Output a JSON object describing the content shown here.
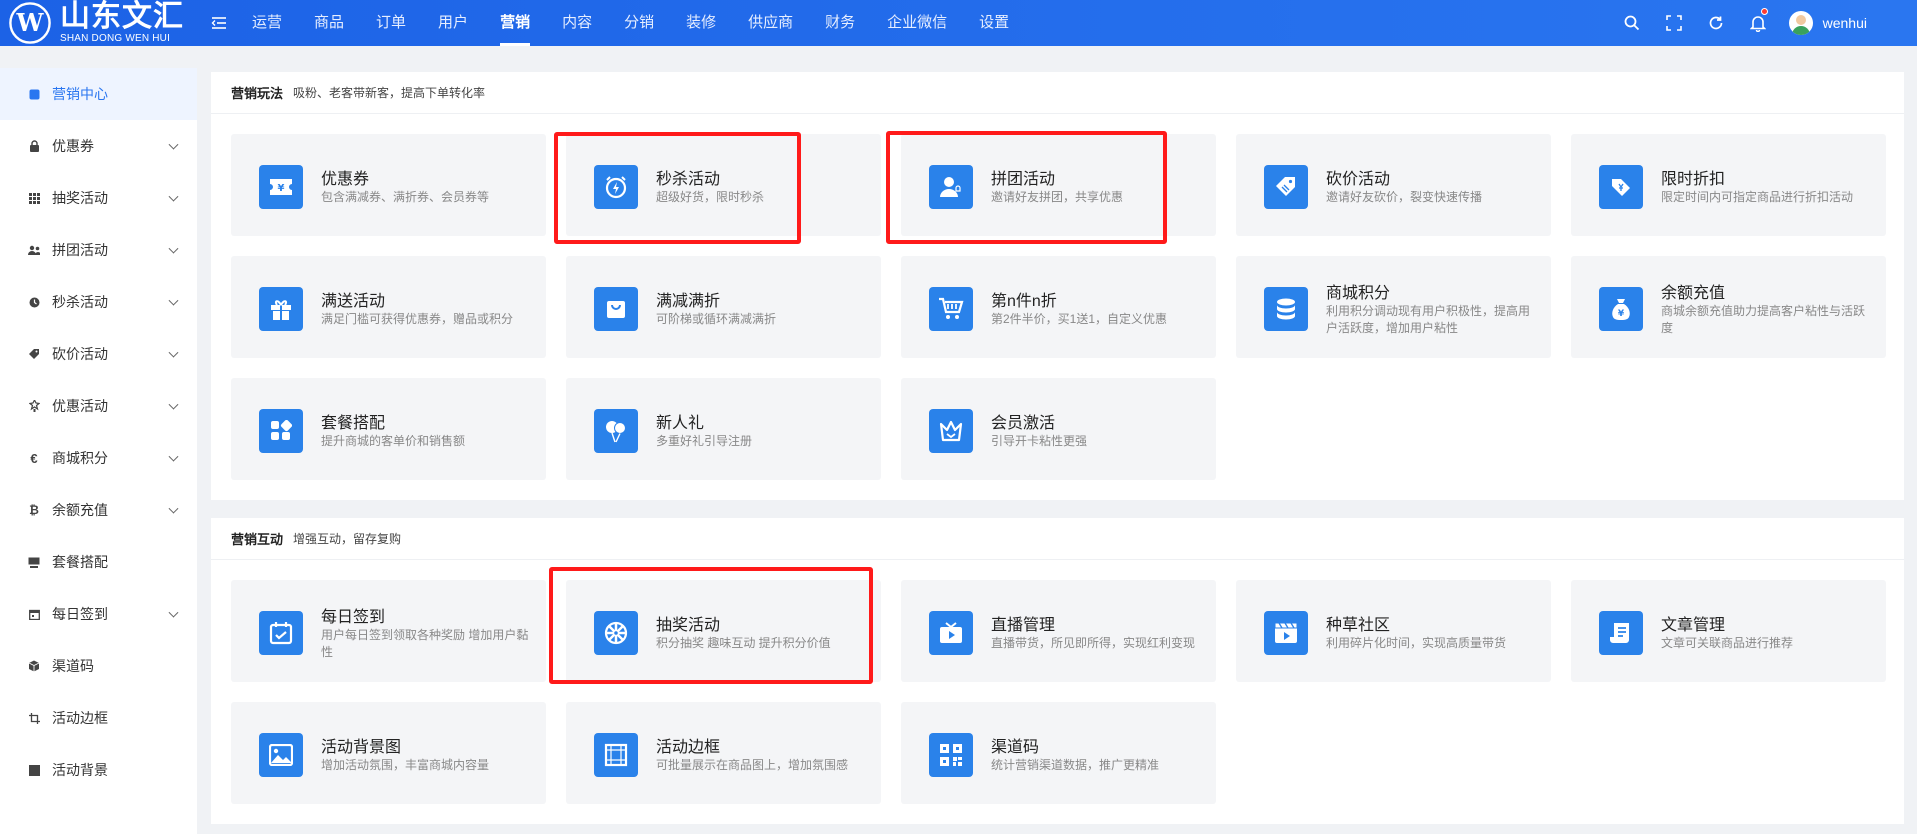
{
  "brand": {
    "name_cn": "山东文汇",
    "name_en": "SHAN DONG WEN HUI",
    "logo_letter": "W"
  },
  "nav": {
    "items": [
      {
        "label": "运营"
      },
      {
        "label": "商品"
      },
      {
        "label": "订单"
      },
      {
        "label": "用户"
      },
      {
        "label": "营销",
        "active": true
      },
      {
        "label": "内容"
      },
      {
        "label": "分销"
      },
      {
        "label": "装修"
      },
      {
        "label": "供应商"
      },
      {
        "label": "财务"
      },
      {
        "label": "企业微信"
      },
      {
        "label": "设置"
      }
    ]
  },
  "user": {
    "name": "wenhui",
    "has_notification": true
  },
  "sidebar": {
    "items": [
      {
        "label": "营销中心",
        "icon": "square-icon",
        "active": true,
        "expandable": false
      },
      {
        "label": "优惠券",
        "icon": "lock-icon",
        "expandable": true
      },
      {
        "label": "抽奖活动",
        "icon": "grid-icon",
        "expandable": true
      },
      {
        "label": "拼团活动",
        "icon": "users-icon",
        "expandable": true
      },
      {
        "label": "秒杀活动",
        "icon": "clock-icon",
        "expandable": true
      },
      {
        "label": "砍价活动",
        "icon": "tag-icon",
        "expandable": true
      },
      {
        "label": "优惠活动",
        "icon": "gift-icon",
        "expandable": true
      },
      {
        "label": "商城积分",
        "icon": "euro-icon",
        "expandable": true
      },
      {
        "label": "余额充值",
        "icon": "bitcoin-icon",
        "expandable": true
      },
      {
        "label": "套餐搭配",
        "icon": "package-icon",
        "expandable": false
      },
      {
        "label": "每日签到",
        "icon": "calendar-icon",
        "expandable": true
      },
      {
        "label": "渠道码",
        "icon": "cube-icon",
        "expandable": false
      },
      {
        "label": "活动边框",
        "icon": "crop-icon",
        "expandable": false
      },
      {
        "label": "活动背景",
        "icon": "image-icon",
        "expandable": false
      }
    ]
  },
  "section1": {
    "title": "营销玩法",
    "subtitle": "吸粉、老客带新客，提高下单转化率",
    "cards": [
      {
        "title": "优惠券",
        "desc": "包含满减券、满折券、会员券等",
        "icon": "coupon-icon"
      },
      {
        "title": "秒杀活动",
        "desc": "超级好货，限时秒杀",
        "icon": "alarm-icon"
      },
      {
        "title": "拼团活动",
        "desc": "邀请好友拼团，共享优惠",
        "icon": "group-icon"
      },
      {
        "title": "砍价活动",
        "desc": "邀请好友砍价，裂变快速传播",
        "icon": "bargain-icon"
      },
      {
        "title": "限时折扣",
        "desc": "限定时间内可指定商品进行折扣活动",
        "icon": "discount-icon"
      },
      {
        "title": "满送活动",
        "desc": "满足门槛可获得优惠券，赠品或积分",
        "icon": "gift-icon"
      },
      {
        "title": "满减满折",
        "desc": "可阶梯或循环满减满折",
        "icon": "bag-icon"
      },
      {
        "title": "第n件n折",
        "desc": "第2件半价，买1送1，自定义优惠",
        "icon": "cart-icon"
      },
      {
        "title": "商城积分",
        "desc": "利用积分调动现有用户积极性，提高用户活跃度，增加用户粘性",
        "icon": "coins-icon"
      },
      {
        "title": "余额充值",
        "desc": "商城余额充值助力提高客户粘性与活跃度",
        "icon": "moneybag-icon"
      },
      {
        "title": "套餐搭配",
        "desc": "提升商城的客单价和销售额",
        "icon": "apps-icon"
      },
      {
        "title": "新人礼",
        "desc": "多重好礼引导注册",
        "icon": "balloon-icon"
      },
      {
        "title": "会员激活",
        "desc": "引导开卡粘性更强",
        "icon": "crown-icon"
      }
    ]
  },
  "section2": {
    "title": "营销互动",
    "subtitle": "增强互动，留存复购",
    "cards": [
      {
        "title": "每日签到",
        "desc": "用户每日签到领取各种奖励 增加用户黏性",
        "icon": "checkin-icon"
      },
      {
        "title": "抽奖活动",
        "desc": "积分抽奖 趣味互动 提升积分价值",
        "icon": "wheel-icon"
      },
      {
        "title": "直播管理",
        "desc": "直播带货，所见即所得，实现红利变现",
        "icon": "live-icon"
      },
      {
        "title": "种草社区",
        "desc": "利用碎片化时间，实现高质量带货",
        "icon": "video-icon"
      },
      {
        "title": "文章管理",
        "desc": "文章可关联商品进行推荐",
        "icon": "article-icon"
      },
      {
        "title": "活动背景图",
        "desc": "增加活动氛围，丰富商城内容量",
        "icon": "picture-icon"
      },
      {
        "title": "活动边框",
        "desc": "可批量展示在商品图上，增加氛围感",
        "icon": "frame-icon"
      },
      {
        "title": "渠道码",
        "desc": "统计营销渠道数据，推广更精准",
        "icon": "qrcode-icon"
      }
    ]
  },
  "colors": {
    "topbar": "#2a76f0",
    "accent": "#2a82ea",
    "highlight": "#ff1a1a"
  }
}
